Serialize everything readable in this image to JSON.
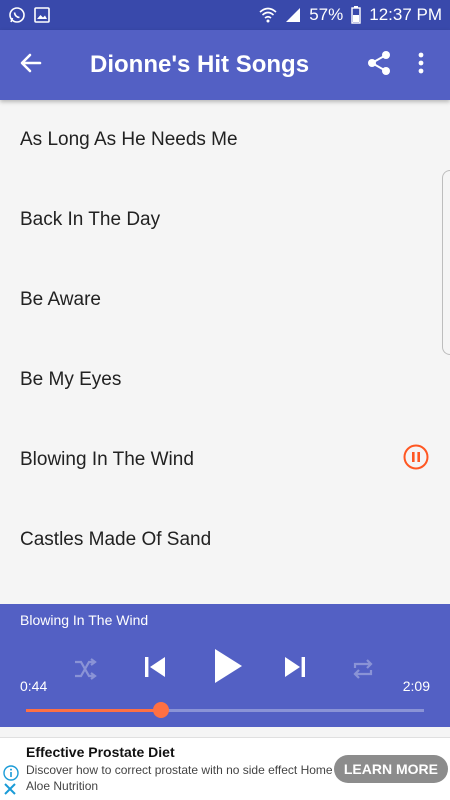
{
  "status_bar": {
    "battery": "57%",
    "time": "12:37 PM",
    "icons": [
      "whatsapp-icon",
      "image-icon",
      "wifi-icon",
      "signal-icon",
      "battery-icon"
    ]
  },
  "app_bar": {
    "title": "Dionne's Hit Songs",
    "icons": [
      "back-arrow-icon",
      "share-icon",
      "more-vert-icon"
    ]
  },
  "songs": [
    {
      "title": "As Long As He Needs Me",
      "playing": false
    },
    {
      "title": "Back In The Day",
      "playing": false
    },
    {
      "title": "Be Aware",
      "playing": false
    },
    {
      "title": "Be My Eyes",
      "playing": false
    },
    {
      "title": "Blowing In The Wind",
      "playing": true
    },
    {
      "title": "Castles Made Of Sand",
      "playing": false
    }
  ],
  "player": {
    "now_playing": "Blowing In The Wind",
    "elapsed": "0:44",
    "duration": "2:09",
    "progress": 0.34,
    "controls": [
      "shuffle-icon",
      "previous-icon",
      "play-icon",
      "next-icon",
      "repeat-icon"
    ]
  },
  "ad": {
    "title": "Effective Prostate Diet",
    "description": "Discover how to correct prostate with no side effect Home Aloe Nutrition",
    "cta": "LEARN MORE"
  },
  "colors": {
    "status_bar": "#3949ab",
    "primary": "#5360c4",
    "accent": "#ff5722",
    "seek": "#ff7043"
  }
}
